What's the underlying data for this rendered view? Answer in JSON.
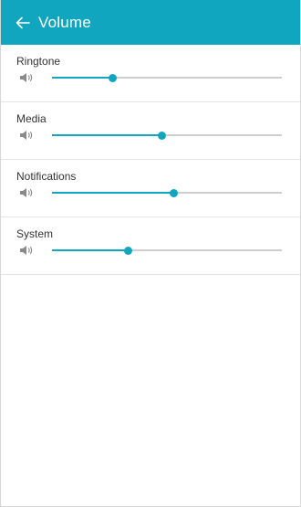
{
  "header": {
    "title": "Volume",
    "back_icon": "arrow-left-icon",
    "color": "#10a6bf"
  },
  "volumes": [
    {
      "label": "Ringtone",
      "level": 0.265,
      "icon": "speaker-icon"
    },
    {
      "label": "Media",
      "level": 0.48,
      "icon": "speaker-icon"
    },
    {
      "label": "Notifications",
      "level": 0.53,
      "icon": "speaker-icon"
    },
    {
      "label": "System",
      "level": 0.33,
      "icon": "speaker-icon"
    }
  ]
}
